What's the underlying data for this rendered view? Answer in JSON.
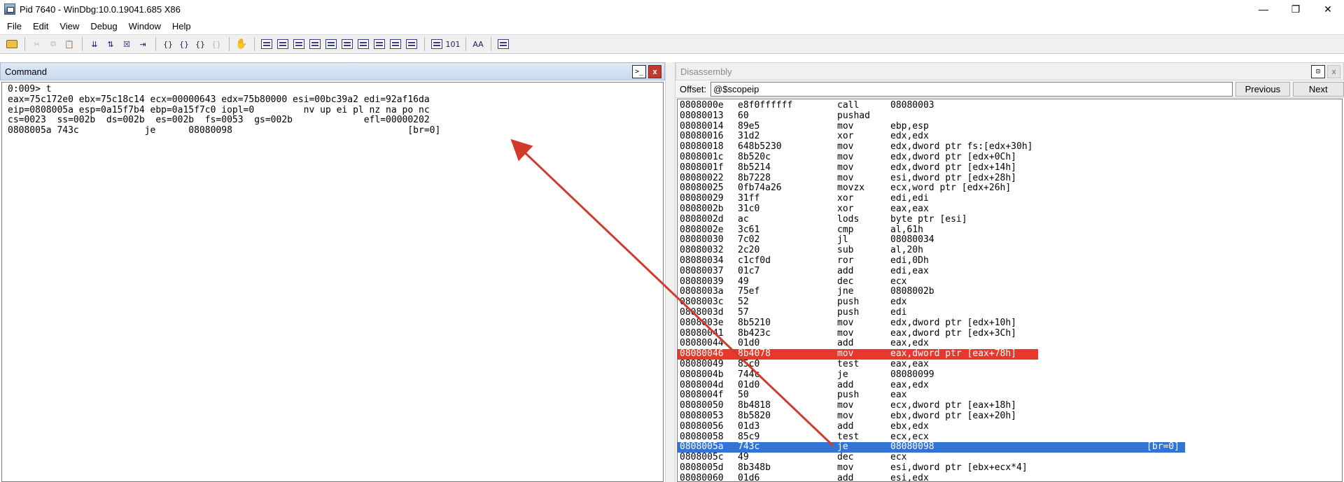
{
  "window": {
    "title": "Pid 7640 - WinDbg:10.0.19041.685 X86",
    "minimize_glyph": "—",
    "maximize_glyph": "❐",
    "close_glyph": "✕"
  },
  "menu": [
    "File",
    "Edit",
    "View",
    "Debug",
    "Window",
    "Help"
  ],
  "toolbar": {
    "groups": [
      [
        {
          "icon": "open-icon",
          "glyph": "",
          "enabled": true
        }
      ],
      [
        {
          "icon": "cut-icon",
          "glyph": "✂",
          "enabled": false
        },
        {
          "icon": "copy-icon",
          "glyph": "⧉",
          "enabled": false
        },
        {
          "icon": "paste-icon",
          "glyph": "📋",
          "enabled": true
        }
      ],
      [
        {
          "icon": "go-icon",
          "glyph": "⇊",
          "enabled": true
        },
        {
          "icon": "restart-icon",
          "glyph": "⇅",
          "enabled": true
        },
        {
          "icon": "stop-debugging-icon",
          "glyph": "☒",
          "enabled": true
        },
        {
          "icon": "detach-icon",
          "glyph": "⇥",
          "enabled": true
        }
      ],
      [
        {
          "icon": "step-into-icon",
          "glyph": "{}",
          "enabled": true
        },
        {
          "icon": "step-over-icon",
          "glyph": "{}",
          "enabled": true
        },
        {
          "icon": "step-out-icon",
          "glyph": "{}",
          "enabled": true
        },
        {
          "icon": "run-to-cursor-icon",
          "glyph": "{}",
          "enabled": false
        }
      ],
      [
        {
          "icon": "break-hand-icon",
          "glyph": "✋",
          "enabled": true
        }
      ],
      [
        {
          "icon": "command-window-icon",
          "glyph": "",
          "enabled": true
        },
        {
          "icon": "watch-window-icon",
          "glyph": "",
          "enabled": true
        },
        {
          "icon": "locals-window-icon",
          "glyph": "",
          "enabled": true
        },
        {
          "icon": "registers-window-icon",
          "glyph": "",
          "enabled": true
        },
        {
          "icon": "memory-window-icon",
          "glyph": "",
          "enabled": true
        },
        {
          "icon": "call-stack-window-icon",
          "glyph": "",
          "enabled": true
        },
        {
          "icon": "disassembly-window-icon",
          "glyph": "",
          "enabled": true
        },
        {
          "icon": "scratch-pad-icon",
          "glyph": "",
          "enabled": true
        },
        {
          "icon": "processes-threads-icon",
          "glyph": "",
          "enabled": true
        },
        {
          "icon": "source-mode-icon",
          "glyph": "",
          "enabled": true
        }
      ],
      [
        {
          "icon": "source-mode-toggle-icon",
          "glyph": "",
          "enabled": true
        },
        {
          "icon": "hex-mode-icon",
          "glyph": "101",
          "enabled": true
        }
      ],
      [
        {
          "icon": "font-icon",
          "glyph": "AA",
          "enabled": true
        }
      ],
      [
        {
          "icon": "options-icon",
          "glyph": "",
          "enabled": true
        }
      ]
    ]
  },
  "command": {
    "title": "Command",
    "dock_glyph": ">_",
    "close_glyph": "x",
    "lines": [
      "0:009> t",
      "eax=75c172e0 ebx=75c18c14 ecx=00000643 edx=75b80000 esi=00bc39a2 edi=92af16da",
      "eip=0808005a esp=0a15f7b4 ebp=0a15f7c0 iopl=0         nv up ei pl nz na po nc",
      "cs=0023  ss=002b  ds=002b  es=002b  fs=0053  gs=002b             efl=00000202",
      "0808005a 743c            je      08080098                                [br=0]"
    ]
  },
  "disassembly": {
    "title": "Disassembly",
    "dock_glyph": "⊡",
    "close_glyph": "x",
    "offset_label": "Offset:",
    "offset_value": "@$scopeip",
    "previous_label": "Previous",
    "next_label": "Next",
    "rows": [
      {
        "addr": "0808000e",
        "bytes": "e8f0ffffff",
        "mn": "call",
        "op": "08080003",
        "ann": "",
        "hl": ""
      },
      {
        "addr": "08080013",
        "bytes": "60",
        "mn": "pushad",
        "op": "",
        "ann": "",
        "hl": ""
      },
      {
        "addr": "08080014",
        "bytes": "89e5",
        "mn": "mov",
        "op": "ebp,esp",
        "ann": "",
        "hl": ""
      },
      {
        "addr": "08080016",
        "bytes": "31d2",
        "mn": "xor",
        "op": "edx,edx",
        "ann": "",
        "hl": ""
      },
      {
        "addr": "08080018",
        "bytes": "648b5230",
        "mn": "mov",
        "op": "edx,dword ptr fs:[edx+30h]",
        "ann": "",
        "hl": ""
      },
      {
        "addr": "0808001c",
        "bytes": "8b520c",
        "mn": "mov",
        "op": "edx,dword ptr [edx+0Ch]",
        "ann": "",
        "hl": ""
      },
      {
        "addr": "0808001f",
        "bytes": "8b5214",
        "mn": "mov",
        "op": "edx,dword ptr [edx+14h]",
        "ann": "",
        "hl": ""
      },
      {
        "addr": "08080022",
        "bytes": "8b7228",
        "mn": "mov",
        "op": "esi,dword ptr [edx+28h]",
        "ann": "",
        "hl": ""
      },
      {
        "addr": "08080025",
        "bytes": "0fb74a26",
        "mn": "movzx",
        "op": "ecx,word ptr [edx+26h]",
        "ann": "",
        "hl": ""
      },
      {
        "addr": "08080029",
        "bytes": "31ff",
        "mn": "xor",
        "op": "edi,edi",
        "ann": "",
        "hl": ""
      },
      {
        "addr": "0808002b",
        "bytes": "31c0",
        "mn": "xor",
        "op": "eax,eax",
        "ann": "",
        "hl": ""
      },
      {
        "addr": "0808002d",
        "bytes": "ac",
        "mn": "lods",
        "op": "byte ptr [esi]",
        "ann": "",
        "hl": ""
      },
      {
        "addr": "0808002e",
        "bytes": "3c61",
        "mn": "cmp",
        "op": "al,61h",
        "ann": "",
        "hl": ""
      },
      {
        "addr": "08080030",
        "bytes": "7c02",
        "mn": "jl",
        "op": "08080034",
        "ann": "",
        "hl": ""
      },
      {
        "addr": "08080032",
        "bytes": "2c20",
        "mn": "sub",
        "op": "al,20h",
        "ann": "",
        "hl": ""
      },
      {
        "addr": "08080034",
        "bytes": "c1cf0d",
        "mn": "ror",
        "op": "edi,0Dh",
        "ann": "",
        "hl": ""
      },
      {
        "addr": "08080037",
        "bytes": "01c7",
        "mn": "add",
        "op": "edi,eax",
        "ann": "",
        "hl": ""
      },
      {
        "addr": "08080039",
        "bytes": "49",
        "mn": "dec",
        "op": "ecx",
        "ann": "",
        "hl": ""
      },
      {
        "addr": "0808003a",
        "bytes": "75ef",
        "mn": "jne",
        "op": "0808002b",
        "ann": "",
        "hl": ""
      },
      {
        "addr": "0808003c",
        "bytes": "52",
        "mn": "push",
        "op": "edx",
        "ann": "",
        "hl": ""
      },
      {
        "addr": "0808003d",
        "bytes": "57",
        "mn": "push",
        "op": "edi",
        "ann": "",
        "hl": ""
      },
      {
        "addr": "0808003e",
        "bytes": "8b5210",
        "mn": "mov",
        "op": "edx,dword ptr [edx+10h]",
        "ann": "",
        "hl": ""
      },
      {
        "addr": "08080041",
        "bytes": "8b423c",
        "mn": "mov",
        "op": "eax,dword ptr [edx+3Ch]",
        "ann": "",
        "hl": ""
      },
      {
        "addr": "08080044",
        "bytes": "01d0",
        "mn": "add",
        "op": "eax,edx",
        "ann": "",
        "hl": ""
      },
      {
        "addr": "08080046",
        "bytes": "8b4078",
        "mn": "mov",
        "op": "eax,dword ptr [eax+78h]",
        "ann": "",
        "hl": "red"
      },
      {
        "addr": "08080049",
        "bytes": "85c0",
        "mn": "test",
        "op": "eax,eax",
        "ann": "",
        "hl": ""
      },
      {
        "addr": "0808004b",
        "bytes": "744c",
        "mn": "je",
        "op": "08080099",
        "ann": "",
        "hl": ""
      },
      {
        "addr": "0808004d",
        "bytes": "01d0",
        "mn": "add",
        "op": "eax,edx",
        "ann": "",
        "hl": ""
      },
      {
        "addr": "0808004f",
        "bytes": "50",
        "mn": "push",
        "op": "eax",
        "ann": "",
        "hl": ""
      },
      {
        "addr": "08080050",
        "bytes": "8b4818",
        "mn": "mov",
        "op": "ecx,dword ptr [eax+18h]",
        "ann": "",
        "hl": ""
      },
      {
        "addr": "08080053",
        "bytes": "8b5820",
        "mn": "mov",
        "op": "ebx,dword ptr [eax+20h]",
        "ann": "",
        "hl": ""
      },
      {
        "addr": "08080056",
        "bytes": "01d3",
        "mn": "add",
        "op": "ebx,edx",
        "ann": "",
        "hl": ""
      },
      {
        "addr": "08080058",
        "bytes": "85c9",
        "mn": "test",
        "op": "ecx,ecx",
        "ann": "",
        "hl": ""
      },
      {
        "addr": "0808005a",
        "bytes": "743c",
        "mn": "je",
        "op": "08080098",
        "ann": "[br=0]",
        "hl": "blue"
      },
      {
        "addr": "0808005c",
        "bytes": "49",
        "mn": "dec",
        "op": "ecx",
        "ann": "",
        "hl": ""
      },
      {
        "addr": "0808005d",
        "bytes": "8b348b",
        "mn": "mov",
        "op": "esi,dword ptr [ebx+ecx*4]",
        "ann": "",
        "hl": ""
      },
      {
        "addr": "08080060",
        "bytes": "01d6",
        "mn": "add",
        "op": "esi,edx",
        "ann": "",
        "hl": ""
      }
    ]
  },
  "colors": {
    "arrow": "#d23b2c",
    "highlight_red": "#e8372b",
    "highlight_blue": "#3274d3"
  }
}
